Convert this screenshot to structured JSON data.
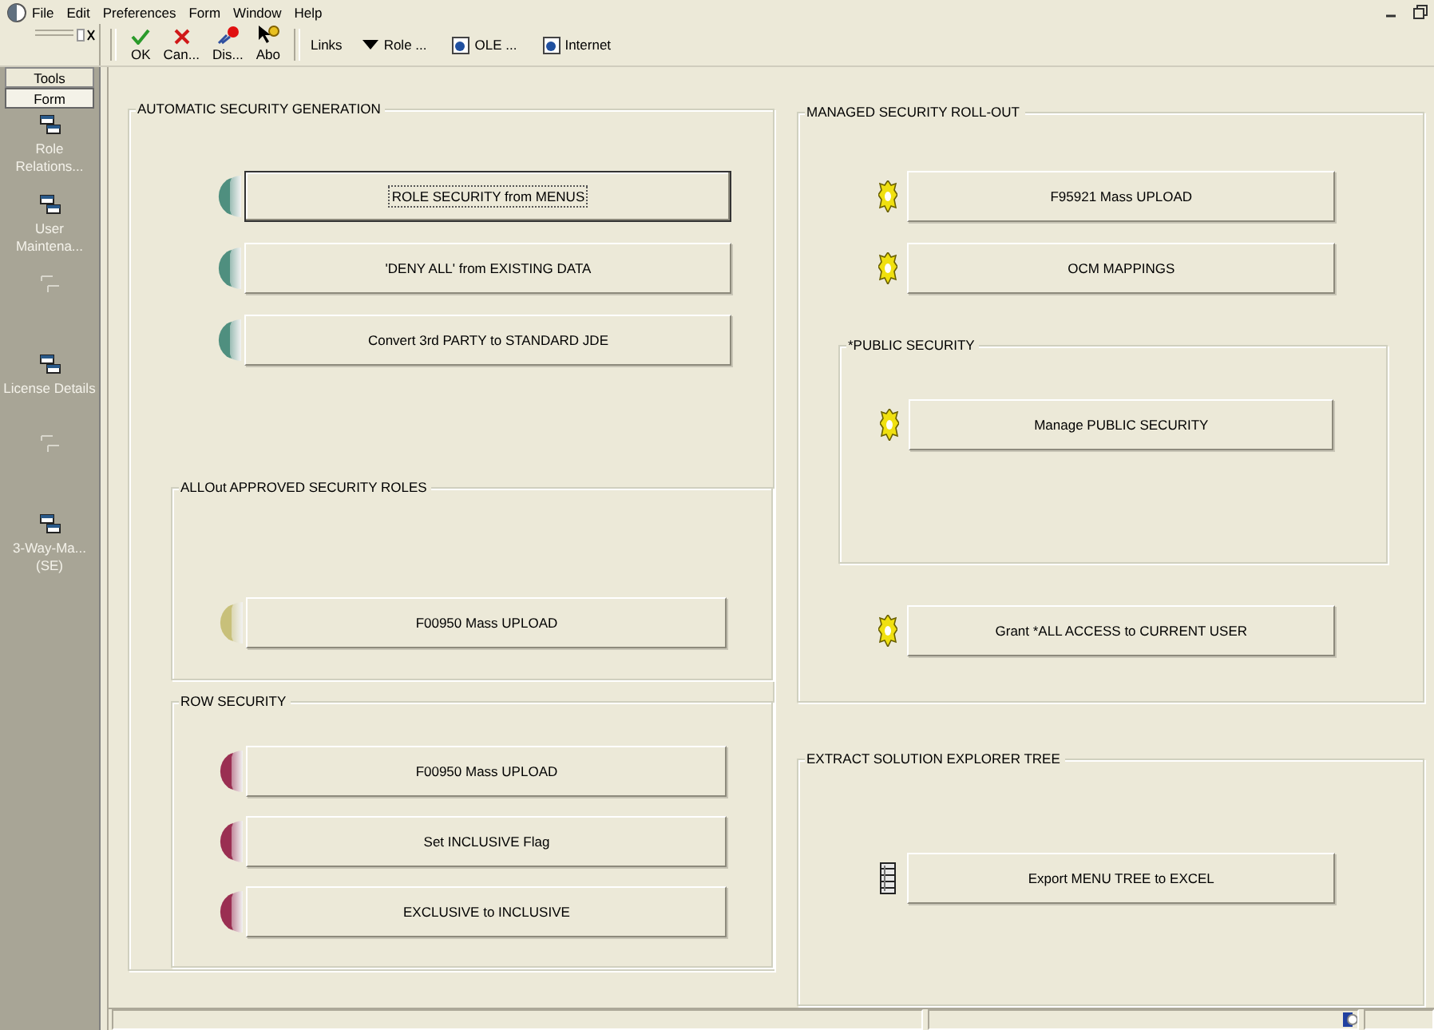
{
  "menu_bar": {
    "items": [
      "File",
      "Edit",
      "Preferences",
      "Form",
      "Window",
      "Help"
    ]
  },
  "toolbar": {
    "buttons": [
      {
        "label": "OK",
        "kind": "check"
      },
      {
        "label": "Can...",
        "kind": "cross"
      },
      {
        "label": "Dis...",
        "kind": "display"
      },
      {
        "label": "Abo",
        "kind": "about"
      }
    ],
    "links": [
      {
        "label": "Links",
        "kind": "text"
      },
      {
        "label": "Role ...",
        "kind": "dropdown"
      },
      {
        "label": "OLE ...",
        "kind": "doc"
      },
      {
        "label": "Internet",
        "kind": "doc"
      }
    ]
  },
  "sidebar": {
    "tabs": [
      {
        "label": "Tools",
        "selected": false
      },
      {
        "label": "Form",
        "selected": true
      }
    ],
    "items": [
      {
        "label": "Role Relations...",
        "disabled": false
      },
      {
        "label": "User Maintena...",
        "disabled": false
      },
      {
        "disabled": true
      },
      {
        "label": "License Details",
        "disabled": false
      },
      {
        "disabled": true
      },
      {
        "label": "3-Way-Ma... (SE)",
        "disabled": false
      }
    ]
  },
  "left_panel": {
    "title": "AUTOMATIC SECURITY GENERATION",
    "items": [
      {
        "kind": "disc",
        "label": "ROLE SECURITY from MENUS",
        "color": "#4f8f7f",
        "focused": true
      },
      {
        "kind": "disc",
        "label": "'DENY ALL' from EXISTING DATA",
        "color": "#4f8f7f",
        "focused": false
      },
      {
        "kind": "disc",
        "label": "Convert 3rd PARTY to STANDARD JDE",
        "color": "#4f8f7f",
        "focused": false
      },
      {
        "kind": "group",
        "title": "ALLOut APPROVED SECURITY ROLES",
        "items": [
          {
            "kind": "disc",
            "label": "F00950 Mass UPLOAD",
            "color": "#c8c07a",
            "focused": false
          }
        ]
      },
      {
        "kind": "group",
        "title": "ROW SECURITY",
        "items": [
          {
            "kind": "disc",
            "label": "F00950 Mass UPLOAD",
            "color": "#9a2f52",
            "focused": false
          },
          {
            "kind": "disc",
            "label": "Set INCLUSIVE Flag",
            "color": "#9a2f52",
            "focused": false
          },
          {
            "kind": "disc",
            "label": "EXCLUSIVE to INCLUSIVE",
            "color": "#9a2f52",
            "focused": false
          }
        ]
      }
    ]
  },
  "right_panels": [
    {
      "title": "MANAGED SECURITY ROLL-OUT",
      "items": [
        {
          "kind": "gear",
          "label": "F95921 Mass UPLOAD",
          "focused": false
        },
        {
          "kind": "gear",
          "label": "OCM MAPPINGS",
          "focused": false
        },
        {
          "kind": "group",
          "title": "*PUBLIC SECURITY",
          "items": [
            {
              "kind": "gear",
              "label": "Manage PUBLIC SECURITY",
              "focused": false
            }
          ]
        },
        {
          "kind": "gear",
          "label": "Grant *ALL ACCESS to CURRENT USER",
          "focused": false
        }
      ]
    },
    {
      "title": "EXTRACT SOLUTION EXPLORER TREE",
      "items": [
        {
          "kind": "cabinet",
          "label": "Export MENU TREE to EXCEL",
          "focused": false
        }
      ]
    }
  ]
}
